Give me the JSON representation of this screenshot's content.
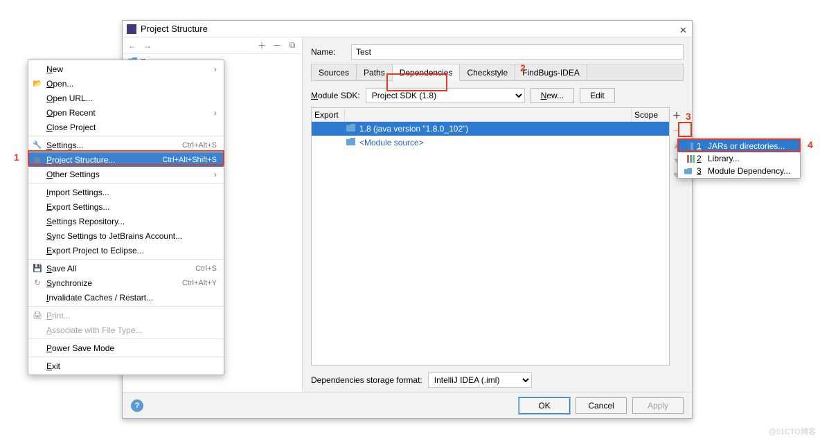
{
  "dialog": {
    "title": "Project Structure",
    "module_name_label": "Name:",
    "module_name_value": "Test",
    "tree_item": "Test",
    "tabs": [
      "Sources",
      "Paths",
      "Dependencies",
      "Checkstyle",
      "FindBugs-IDEA"
    ],
    "active_tab_index": 2,
    "sdk_label": "Module SDK:",
    "sdk_value": "Project SDK (1.8)",
    "sdk_new": "New...",
    "sdk_edit": "Edit",
    "cols": {
      "export": "Export",
      "scope": "Scope"
    },
    "rows": [
      {
        "text": "1.8 (java version \"1.8.0_102\")",
        "selected": true,
        "link": false
      },
      {
        "text": "<Module source>",
        "selected": false,
        "link": true
      }
    ],
    "storage_label": "Dependencies storage format:",
    "storage_value": "IntelliJ IDEA (.iml)",
    "buttons": {
      "ok": "OK",
      "cancel": "Cancel",
      "apply": "Apply"
    }
  },
  "file_menu": {
    "items": [
      {
        "label": "New",
        "submenu": true
      },
      {
        "label": "Open...",
        "icon": "open"
      },
      {
        "label": "Open URL..."
      },
      {
        "label": "Open Recent",
        "submenu": true
      },
      {
        "label": "Close Project"
      },
      {
        "sep": true
      },
      {
        "label": "Settings...",
        "kbd": "Ctrl+Alt+S",
        "icon": "wrench"
      },
      {
        "label": "Project Structure...",
        "kbd": "Ctrl+Alt+Shift+S",
        "icon": "struct",
        "selected": true
      },
      {
        "label": "Other Settings",
        "submenu": true
      },
      {
        "sep": true
      },
      {
        "label": "Import Settings..."
      },
      {
        "label": "Export Settings..."
      },
      {
        "label": "Settings Repository..."
      },
      {
        "label": "Sync Settings to JetBrains Account..."
      },
      {
        "label": "Export Project to Eclipse..."
      },
      {
        "sep": true
      },
      {
        "label": "Save All",
        "kbd": "Ctrl+S",
        "icon": "save"
      },
      {
        "label": "Synchronize",
        "kbd": "Ctrl+Alt+Y",
        "icon": "sync"
      },
      {
        "label": "Invalidate Caches / Restart..."
      },
      {
        "sep": true
      },
      {
        "label": "Print...",
        "disabled": true,
        "icon": "print"
      },
      {
        "label": "Associate with File Type...",
        "disabled": true
      },
      {
        "sep": true
      },
      {
        "label": "Power Save Mode"
      },
      {
        "sep": true
      },
      {
        "label": "Exit"
      }
    ]
  },
  "add_popup": {
    "items": [
      {
        "num": "1",
        "label": "JARs or directories...",
        "icon": "jars",
        "selected": true
      },
      {
        "num": "2",
        "label": "Library...",
        "icon": "lib"
      },
      {
        "num": "3",
        "label": "Module Dependency...",
        "icon": "mod"
      }
    ]
  },
  "annotations": {
    "n1": "1",
    "n2": "2",
    "n3": "3",
    "n4": "4"
  },
  "watermark": "@51CTO博客"
}
